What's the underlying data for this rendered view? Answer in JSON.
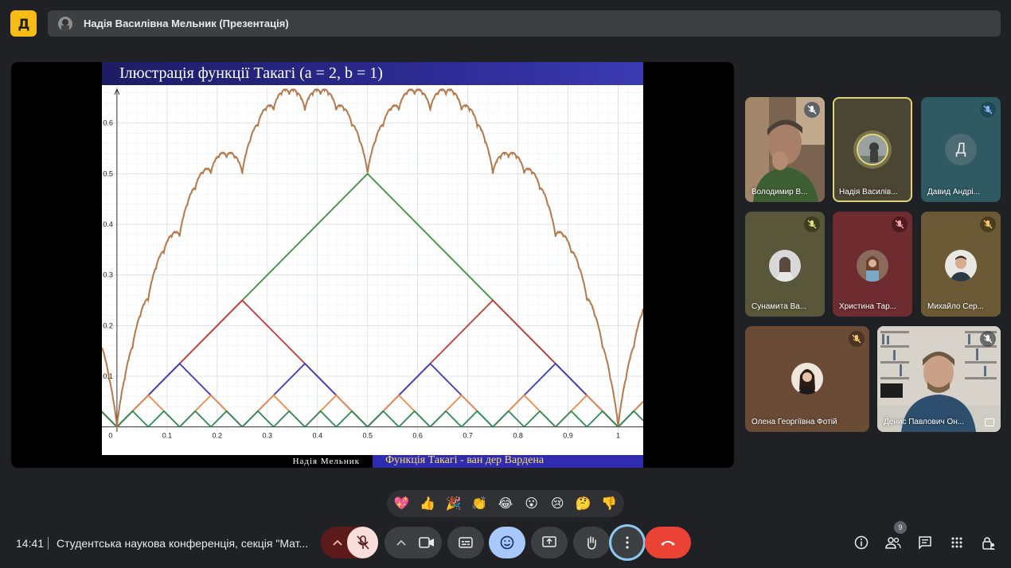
{
  "header": {
    "app_logo_letter": "Д",
    "title": "Надія Василівна Мельник (Презентація)"
  },
  "slide": {
    "title": "Ілюстрація функції Такагі (a = 2, b = 1)",
    "footer_left": "Надія Мельник",
    "footer_right": "Функція Такагі - ван дер Вардена",
    "chart_data": {
      "type": "line",
      "x_ticks": [
        "0",
        "0.1",
        "0.2",
        "0.3",
        "0.4",
        "0.5",
        "0.6",
        "0.7",
        "0.8",
        "0.9",
        "1"
      ],
      "y_ticks": [
        "0.1",
        "0.2",
        "0.3",
        "0.4",
        "0.5",
        "0.6"
      ],
      "xlim": [
        -0.03,
        1.05
      ],
      "ylim": [
        -0.01,
        0.675
      ],
      "grid": true,
      "series": [
        {
          "kind": "triangle",
          "period": 1.0,
          "amplitude": 0.5,
          "color": "#3f8f3f"
        },
        {
          "kind": "triangle",
          "period": 0.5,
          "amplitude": 0.25,
          "color": "#c63838"
        },
        {
          "kind": "triangle",
          "period": 0.25,
          "amplitude": 0.125,
          "color": "#3a3ac2"
        },
        {
          "kind": "triangle",
          "period": 0.125,
          "amplitude": 0.0625,
          "color": "#f08a4b"
        },
        {
          "kind": "triangle",
          "period": 0.0625,
          "amplitude": 0.03125,
          "color": "#2f8a55"
        },
        {
          "kind": "takagi_sum",
          "terms": 12,
          "color": "#b5784a"
        }
      ]
    }
  },
  "participants": [
    {
      "name": "Володимир В...",
      "muted": true,
      "kind": "video"
    },
    {
      "name": "Надія Василів...",
      "muted": false,
      "kind": "speaking"
    },
    {
      "name": "Давид Андрі...",
      "muted": true,
      "kind": "initial",
      "initial": "Д"
    },
    {
      "name": "Сунамита Ва...",
      "muted": true,
      "kind": "avatar"
    },
    {
      "name": "Христина Тар...",
      "muted": true,
      "kind": "avatar"
    },
    {
      "name": "Михайло Сер...",
      "muted": true,
      "kind": "avatar"
    },
    {
      "name": "Олена Георгіївна Фотій",
      "muted": true,
      "kind": "avatar"
    },
    {
      "name": "Денис Павлович Он...",
      "muted": true,
      "kind": "video"
    }
  ],
  "reactions": [
    "💖",
    "👍",
    "🎉",
    "👏",
    "😂",
    "😮",
    "😢",
    "🤔",
    "👎"
  ],
  "bottom": {
    "time": "14:41",
    "meeting": "Студентська наукова конференція, секція \"Мат...",
    "people_count": "9"
  },
  "colors": {
    "end_call": "#ea4335",
    "mic_muted_bg": "#f9dedc",
    "reactions_active": "#a8c7fa",
    "highlight_ring": "#8ab4f8"
  }
}
